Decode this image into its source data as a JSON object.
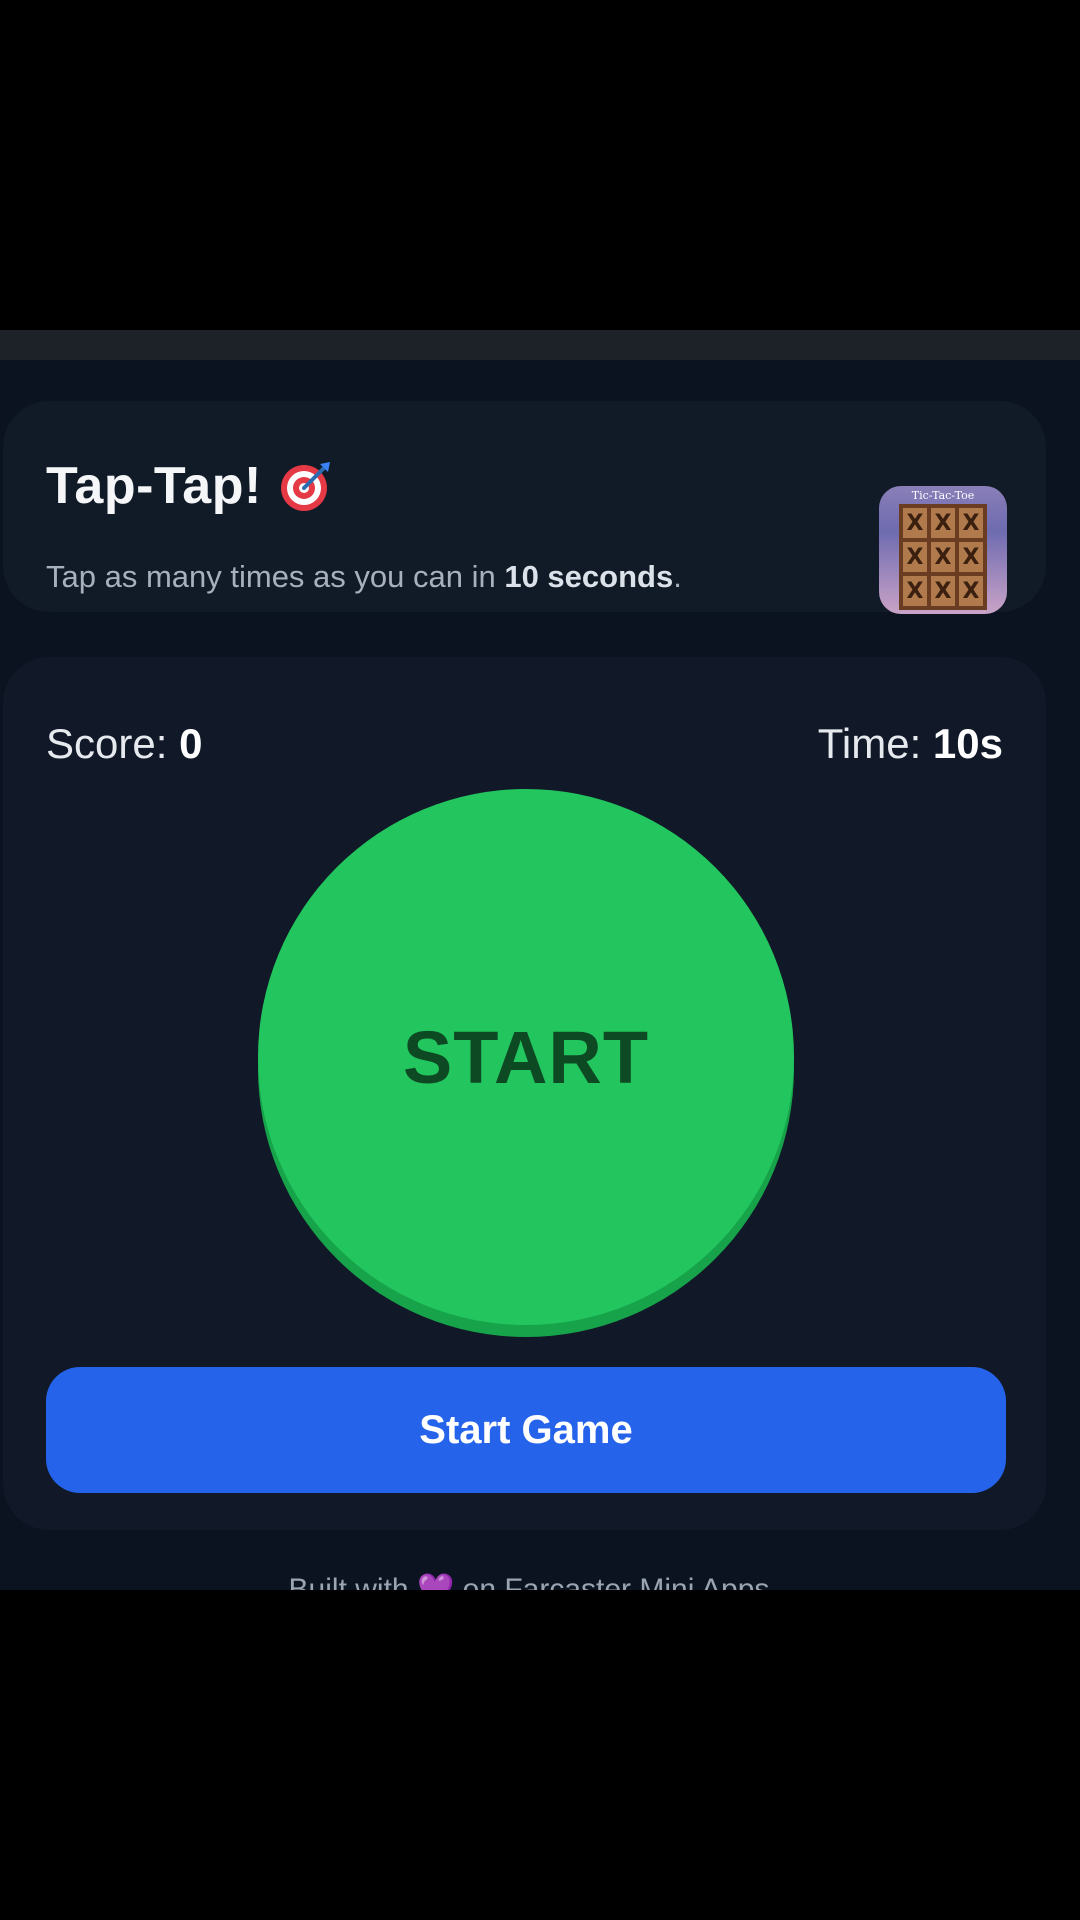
{
  "header": {
    "title": "Tap-Tap!",
    "title_icon": "target-icon",
    "subtitle_prefix": "Tap as many times as you can in ",
    "subtitle_bold": "10 seconds",
    "subtitle_suffix": ".",
    "app_icon": {
      "label": "Tic-Tac-Toe",
      "cells": [
        "X",
        "X",
        "X",
        "X",
        "X",
        "X",
        "X",
        "X",
        "X"
      ]
    }
  },
  "game": {
    "score_label": "Score: ",
    "score_value": "0",
    "time_label": "Time: ",
    "time_value": "10s",
    "tap_button_label": "START",
    "start_button_label": "Start Game"
  },
  "footer": {
    "prefix": "Built with ",
    "heart": "💜",
    "suffix": " on Farcaster Mini Apps"
  },
  "colors": {
    "background": "#0b1320",
    "card": "#111827",
    "tap_button": "#22c55e",
    "start_button": "#2563eb",
    "heart": "#a855f7"
  }
}
